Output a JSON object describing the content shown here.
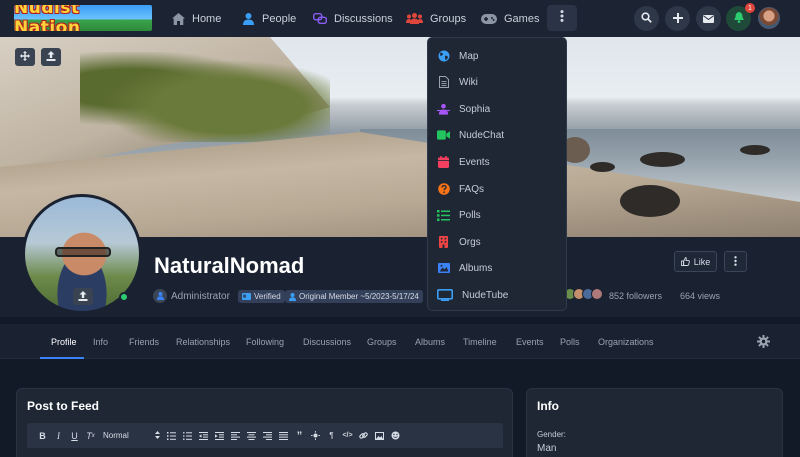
{
  "app": {
    "logo_text": "Nudist Nation"
  },
  "nav": {
    "items": [
      {
        "label": "Home",
        "icon": "home-icon"
      },
      {
        "label": "People",
        "icon": "person-icon"
      },
      {
        "label": "Discussions",
        "icon": "chat-icon"
      },
      {
        "label": "Groups",
        "icon": "groups-icon"
      },
      {
        "label": "Games",
        "icon": "gamepad-icon"
      }
    ],
    "notification_count": "1",
    "colors": {
      "accent": "#3b82f6",
      "groups": "#e0463b",
      "discussions": "#8b5cf6",
      "people": "#3b9ef5"
    }
  },
  "dropdown": {
    "items": [
      {
        "label": "Map",
        "icon": "globe-icon",
        "color": "#3b9ef5"
      },
      {
        "label": "Wiki",
        "icon": "document-icon",
        "color": "#9aa3b0"
      },
      {
        "label": "Sophia",
        "icon": "robot-icon",
        "color": "#a855f7"
      },
      {
        "label": "NudeChat",
        "icon": "video-icon",
        "color": "#22c55e"
      },
      {
        "label": "Events",
        "icon": "calendar-icon",
        "color": "#f43f5e"
      },
      {
        "label": "FAQs",
        "icon": "question-icon",
        "color": "#f97316"
      },
      {
        "label": "Polls",
        "icon": "list-icon",
        "color": "#22c55e"
      },
      {
        "label": "Orgs",
        "icon": "building-icon",
        "color": "#ef4444"
      },
      {
        "label": "Albums",
        "icon": "image-icon",
        "color": "#3b82f6"
      },
      {
        "label": "NudeTube",
        "icon": "tv-icon",
        "color": "#3b9ef5"
      }
    ]
  },
  "profile": {
    "username": "NaturalNomad",
    "role": "Administrator",
    "tags": [
      "Verified",
      "Original Member ~5/2023-5/17/24"
    ],
    "followers": "852 followers",
    "views": "664 views",
    "like_label": "Like",
    "online": true
  },
  "tabs": [
    "Profile",
    "Info",
    "Friends",
    "Relationships",
    "Following",
    "Discussions",
    "Groups",
    "Albums",
    "Timeline",
    "Events",
    "Polls",
    "Organizations"
  ],
  "feed": {
    "title": "Post to Feed",
    "style_select": "Normal"
  },
  "info": {
    "title": "Info",
    "gender_label": "Gender:",
    "gender_value": "Man"
  }
}
